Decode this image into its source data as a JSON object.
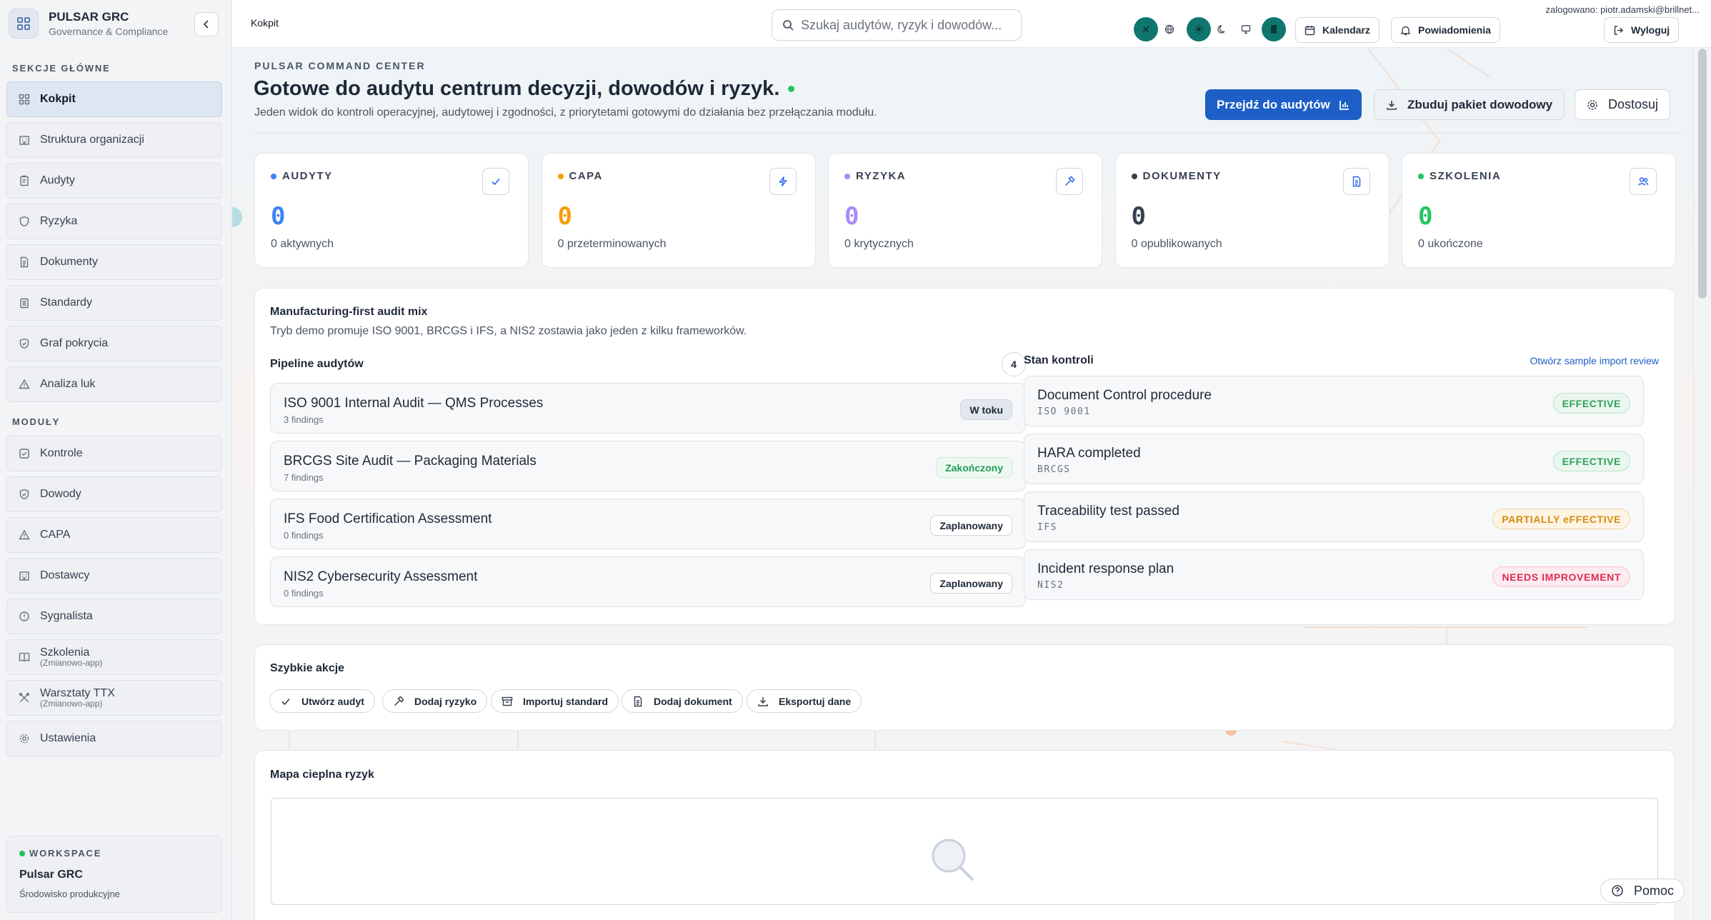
{
  "app": {
    "name": "PULSAR GRC",
    "subtitle": "Governance & Compliance",
    "icons": {
      "logo": "grid-icon",
      "collapse": "chevron-left-icon"
    }
  },
  "sidebar": {
    "main_title": "SEKCJE GŁÓWNE",
    "main_items": [
      {
        "label": "Kokpit",
        "icon": "grid-icon",
        "active": true
      },
      {
        "label": "Struktura organizacji",
        "icon": "building-icon"
      },
      {
        "label": "Audyty",
        "icon": "clipboard-icon"
      },
      {
        "label": "Ryzyka",
        "icon": "shield-icon"
      },
      {
        "label": "Dokumenty",
        "icon": "document-icon"
      },
      {
        "label": "Standardy",
        "icon": "clipboard-list-icon"
      },
      {
        "label": "Graf pokrycia",
        "icon": "shield-check-icon"
      },
      {
        "label": "Analiza luk",
        "icon": "warning-icon"
      }
    ],
    "modules_title": "MODUŁY",
    "module_items": [
      {
        "label": "Kontrole",
        "icon": "checkbox-icon"
      },
      {
        "label": "Dowody",
        "icon": "shield-check-icon"
      },
      {
        "label": "CAPA",
        "icon": "warning-icon"
      },
      {
        "label": "Dostawcy",
        "icon": "building-icon"
      },
      {
        "label": "Sygnalista",
        "icon": "alert-circle-icon"
      },
      {
        "label": "Szkolenia",
        "sub": "(Zmianowo-app)",
        "icon": "book-icon"
      },
      {
        "label": "Warsztaty TTX",
        "sub": "(Zmianowo-app)",
        "icon": "tools-icon"
      },
      {
        "label": "Ustawienia",
        "icon": "gear-icon"
      }
    ],
    "workspace": {
      "label": "WORKSPACE",
      "name": "Pulsar GRC",
      "env": "Środowisko produkcyjne"
    }
  },
  "topbar": {
    "breadcrumb": "Kokpit",
    "search_placeholder": "Szukaj audytów, ryzyk i dowodów...",
    "calendar_label": "Kalendarz",
    "notifications_label": "Powiadomienia",
    "logout_label": "Wyloguj",
    "user_line": "zalogowano: piotr.adamski@brillnet..."
  },
  "hero": {
    "eyebrow": "PULSAR COMMAND CENTER",
    "title": "Gotowe do audytu centrum decyzji, dowodów i ryzyk.",
    "subtitle": "Jeden widok do kontroli operacyjnej, audytowej i zgodności, z priorytetami gotowymi do działania bez przełączania modułu.",
    "btn_audits": "Przejdź do audytów",
    "btn_evidence": "Zbuduj pakiet dowodowy",
    "btn_customize": "Dostosuj"
  },
  "stats": [
    {
      "label": "AUDYTY",
      "value": "0",
      "sub": "0 aktywnych",
      "color": "#3b82f6",
      "icon": "check-icon"
    },
    {
      "label": "CAPA",
      "value": "0",
      "sub": "0 przeterminowanych",
      "color": "#f59e0b",
      "icon": "lightning-icon"
    },
    {
      "label": "RYZYKA",
      "value": "0",
      "sub": "0 krytycznych",
      "color": "#a78bfa",
      "icon": "hammer-icon"
    },
    {
      "label": "DOKUMENTY",
      "value": "0",
      "sub": "0 opublikowanych",
      "color": "#374151",
      "icon": "document-icon"
    },
    {
      "label": "SZKOLENIA",
      "value": "0",
      "sub": "0 ukończone",
      "color": "#22c55e",
      "icon": "users-icon"
    }
  ],
  "mix": {
    "title": "Manufacturing-first audit mix",
    "desc": "Tryb demo promuje ISO 9001, BRCGS i IFS, a NIS2 zostawia jako jeden z kilku frameworków.",
    "pipeline_title": "Pipeline audytów",
    "pipeline_count": "4",
    "audits": [
      {
        "name": "ISO 9001 Internal Audit — QMS Processes",
        "findings": "3 findings",
        "status": "W toku",
        "kind": "progress"
      },
      {
        "name": "BRCGS Site Audit — Packaging Materials",
        "findings": "7 findings",
        "status": "Zakończony",
        "kind": "done"
      },
      {
        "name": "IFS Food Certification Assessment",
        "findings": "0 findings",
        "status": "Zaplanowany",
        "kind": "planned"
      },
      {
        "name": "NIS2 Cybersecurity Assessment",
        "findings": "0 findings",
        "status": "Zaplanowany",
        "kind": "planned"
      }
    ],
    "controls_title": "Stan kontroli",
    "controls_link": "Otwórz sample import review",
    "controls": [
      {
        "name": "Document Control procedure",
        "tag": "ISO 9001",
        "status": "EFFECTIVE",
        "kind": "green"
      },
      {
        "name": "HARA completed",
        "tag": "BRCGS",
        "status": "EFFECTIVE",
        "kind": "green"
      },
      {
        "name": "Traceability test passed",
        "tag": "IFS",
        "status": "PARTIALLY eFFECTIVE",
        "kind": "amber"
      },
      {
        "name": "Incident response plan",
        "tag": "NIS2",
        "status": "NEEDS IMPROVEMENT",
        "kind": "red"
      }
    ]
  },
  "quick": {
    "title": "Szybkie akcje",
    "actions": [
      {
        "label": "Utwórz audyt",
        "icon": "check-icon"
      },
      {
        "label": "Dodaj ryzyko",
        "icon": "hammer-icon"
      },
      {
        "label": "Importuj standard",
        "icon": "archive-icon"
      },
      {
        "label": "Dodaj dokument",
        "icon": "document-icon"
      },
      {
        "label": "Eksportuj dane",
        "icon": "download-icon"
      }
    ]
  },
  "heatmap": {
    "title": "Mapa cieplna ryzyk"
  },
  "help": {
    "label": "Pomoc"
  },
  "colors": {
    "primary": "#1d5fc6",
    "teal": "#0f766e",
    "online": "#22c55e"
  }
}
